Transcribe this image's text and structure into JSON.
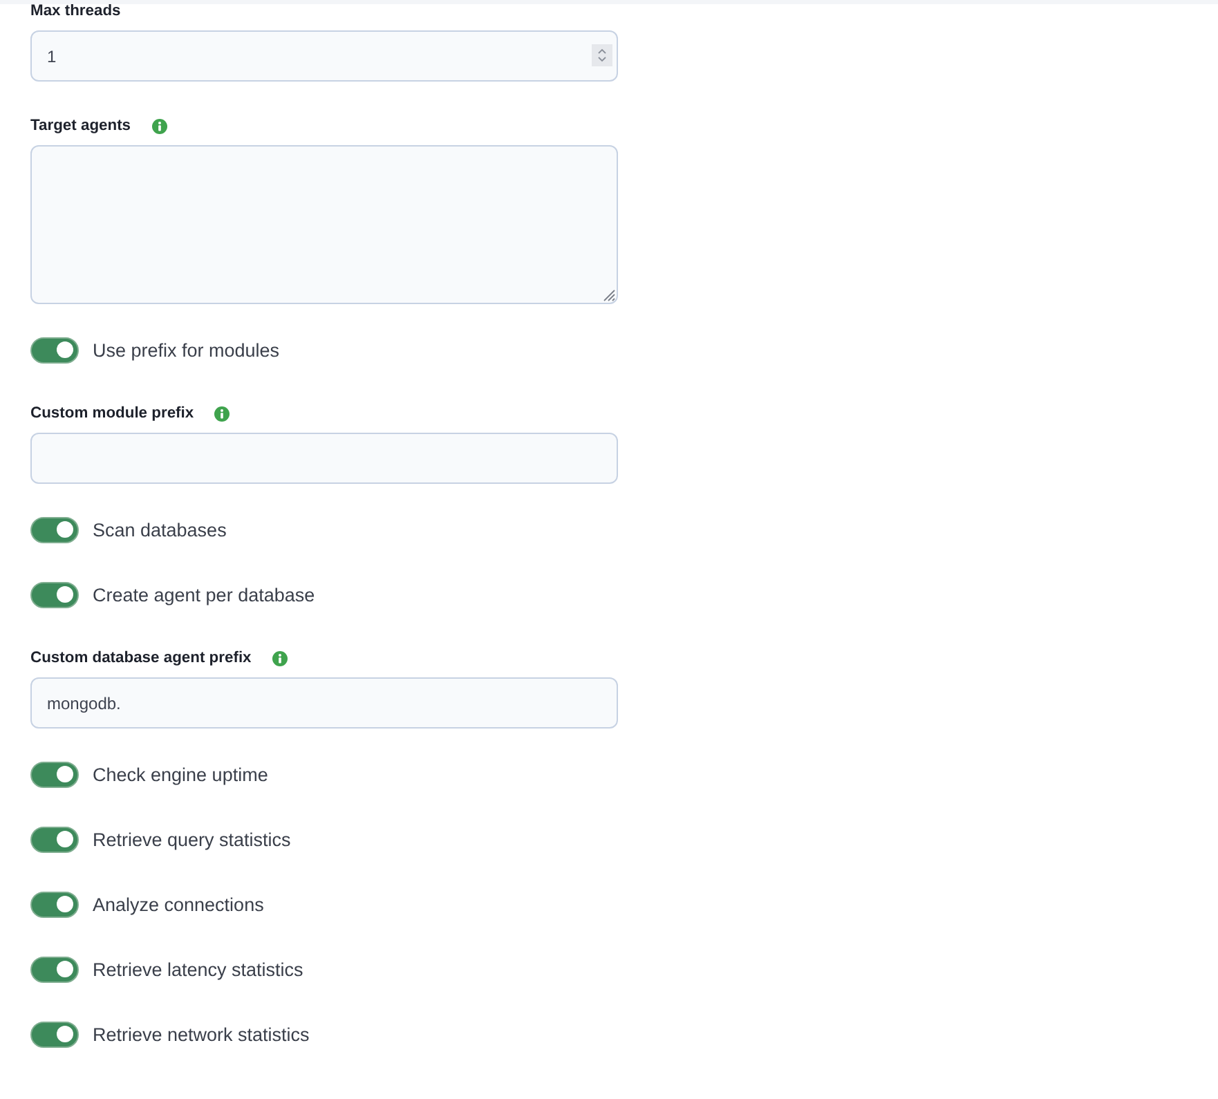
{
  "fields": [
    {
      "kind": "number",
      "label": "Max threads",
      "info": false,
      "value": "1"
    },
    {
      "kind": "textarea",
      "label": "Target agents",
      "info": true
    },
    {
      "kind": "toggle",
      "label": "Use prefix for modules",
      "on": true
    },
    {
      "kind": "text",
      "label": "Custom module prefix",
      "info": true
    },
    {
      "kind": "toggle",
      "label": "Scan databases",
      "on": true
    },
    {
      "kind": "toggle",
      "label": "Create agent per database",
      "on": true
    },
    {
      "kind": "text",
      "label": "Custom database agent prefix",
      "info": true,
      "value": "mongodb."
    },
    {
      "kind": "toggle",
      "label": "Check engine uptime",
      "on": true
    },
    {
      "kind": "toggle",
      "label": "Retrieve query statistics",
      "on": true
    },
    {
      "kind": "toggle",
      "label": "Analyze connections",
      "on": true
    },
    {
      "kind": "toggle",
      "label": "Retrieve latency statistics",
      "on": true
    },
    {
      "kind": "toggle",
      "label": "Retrieve network statistics",
      "on": true
    }
  ]
}
